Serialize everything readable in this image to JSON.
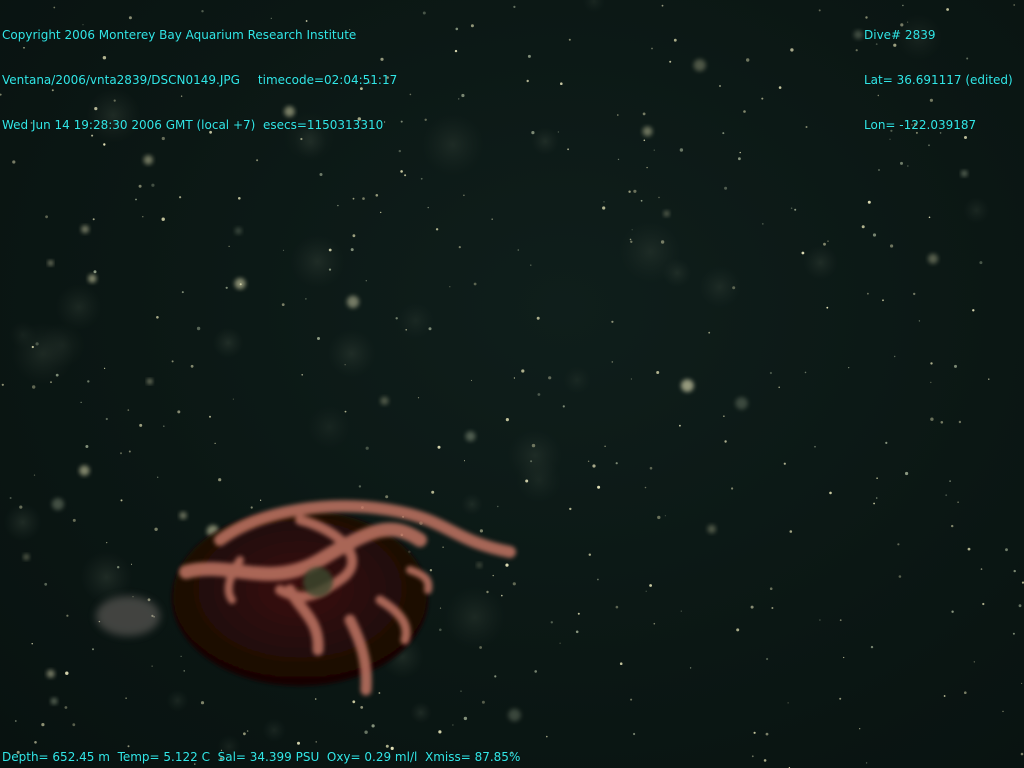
{
  "overlay": {
    "copyright": "Copyright 2006 Monterey Bay Aquarium Research Institute",
    "file_path": "Ventana/2006/vnta2839/DSCN0149.JPG",
    "timecode": "timecode=02:04:51:17",
    "datetime": "Wed Jun 14 19:28:30 2006 GMT (local +7)",
    "esecs": "esecs=1150313310",
    "dive": "Dive# 2839",
    "lat": "Lat= 36.691117 (edited)",
    "lon": "Lon= -122.039187",
    "depth": "Depth= 652.45 m",
    "temp": "Temp= 5.122 C",
    "sal": "Sal= 34.399 PSU",
    "oxy": "Oxy= 0.29 ml/l",
    "xmiss": "Xmiss= 87.85%"
  },
  "colors": {
    "overlay_text": "#32e6e6",
    "water": "#0b1714",
    "animal_body": "#2a0d0a",
    "animal_tentacle": "#b8705f"
  }
}
